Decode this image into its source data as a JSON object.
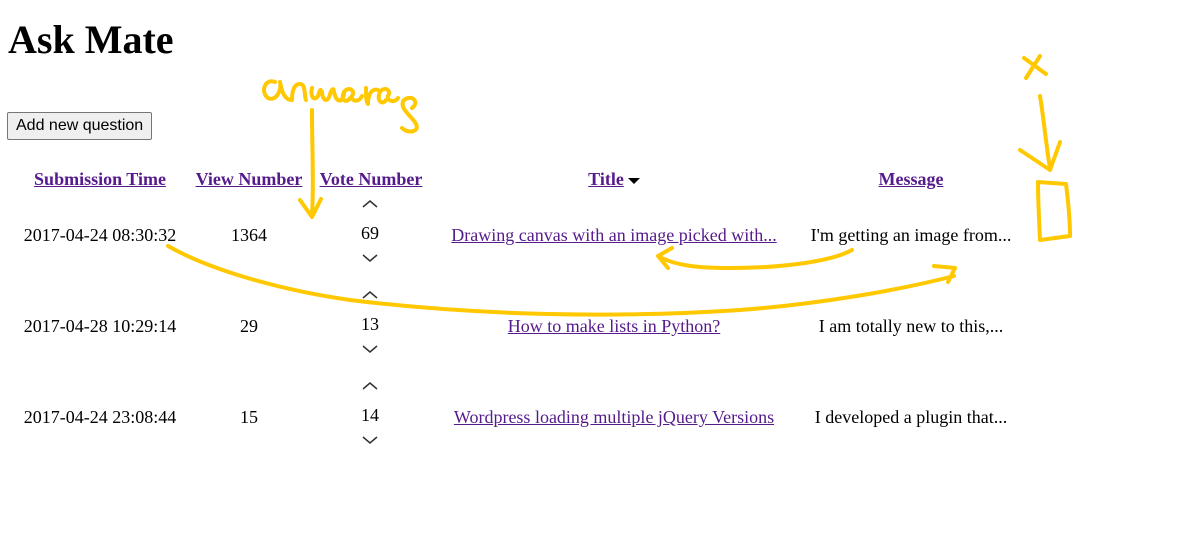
{
  "page": {
    "title": "Ask Mate"
  },
  "toolbar": {
    "add_question_label": "Add new question"
  },
  "table": {
    "headers": {
      "submission_time": "Submission Time",
      "view_number": "View Number",
      "vote_number": "Vote Number",
      "title": "Title",
      "message": "Message"
    },
    "sorted_by": "title",
    "sort_direction": "descending",
    "rows": [
      {
        "submission_time": "2017-04-24 08:30:32",
        "view_number": "1364",
        "vote_number": "69",
        "title": "Drawing canvas with an image picked with...",
        "message": "I'm getting an image from..."
      },
      {
        "submission_time": "2017-04-28 10:29:14",
        "view_number": "29",
        "vote_number": "13",
        "title": "How to make lists in Python?",
        "message": "I am totally new to this,..."
      },
      {
        "submission_time": "2017-04-24 23:08:44",
        "view_number": "15",
        "vote_number": "14",
        "title": "Wordpress loading multiple jQuery Versions",
        "message": "I developed a plugin that..."
      }
    ]
  },
  "annotations": {
    "color": "#ffc800",
    "answers_label": "answers",
    "x_mark": "x"
  }
}
